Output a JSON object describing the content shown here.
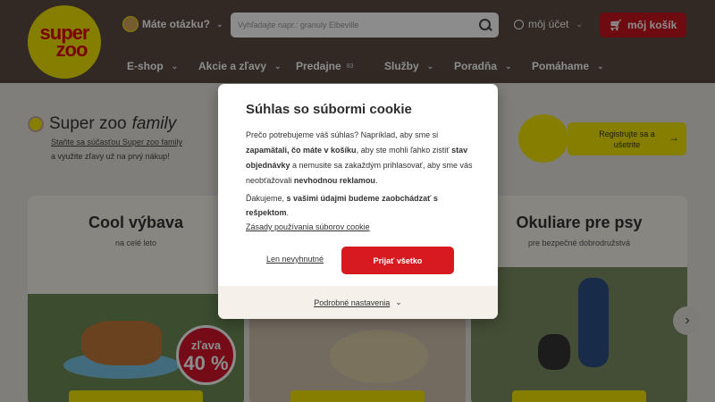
{
  "header": {
    "logo": {
      "line1": "super",
      "line2": "zoo"
    },
    "questions_label": "Máte otázku?",
    "search_placeholder": "Vyhľadajte napr.: granuly Elbeville",
    "account_label": "môj účet",
    "cart_label": "môj košík"
  },
  "nav": [
    {
      "label": "E-shop"
    },
    {
      "label": "Akcie a zľavy"
    },
    {
      "label": "Predajne",
      "count": "83"
    },
    {
      "label": "Služby"
    },
    {
      "label": "Poradňa"
    },
    {
      "label": "Pomáhame"
    }
  ],
  "family": {
    "title_prefix": "Super zoo",
    "title_em": "family",
    "link": "Staňte sa súčasťou Super zoo family",
    "text": "a využite zľavy už na prvý nákup!",
    "register_line1": "Registrujte sa a",
    "register_line2": "ušetrite"
  },
  "panels": [
    {
      "title": "Cool výbava",
      "subtitle": "na celé leto",
      "badge_top": "zľava",
      "badge_value": "40 %"
    },
    {
      "title": "",
      "subtitle": ""
    },
    {
      "title": "Okuliare pre psy",
      "subtitle": "pre bezpečné dobrodružstvá"
    }
  ],
  "modal": {
    "title": "Súhlas so súbormi cookie",
    "p1_a": "Prečo potrebujeme váš súhlas? Napríklad, aby sme si ",
    "p1_b": "zapamätali, čo máte v košíku",
    "p1_c": ", aby ste mohli ľahko zistiť ",
    "p1_d": "stav objednávky",
    "p1_e": " a nemusite sa zakaždým prihlasovať, aby sme vás neobťažovali ",
    "p1_f": "nevhodnou reklamou",
    "p1_g": ".",
    "p2_a": "Ďakujeme, ",
    "p2_b": "s vašimi údajmi budeme zaobchádzať s rešpektom",
    "p2_c": ".",
    "policy_link": "Zásady používania súborov cookie",
    "necessary_button": "Len nevyhnutné",
    "accept_button": "Prijať všetko",
    "settings_link": "Podrobné nastavenia"
  },
  "colors": {
    "header_bg": "#5b4c42",
    "brand_yellow": "#f3e600",
    "brand_red": "#d71920"
  }
}
